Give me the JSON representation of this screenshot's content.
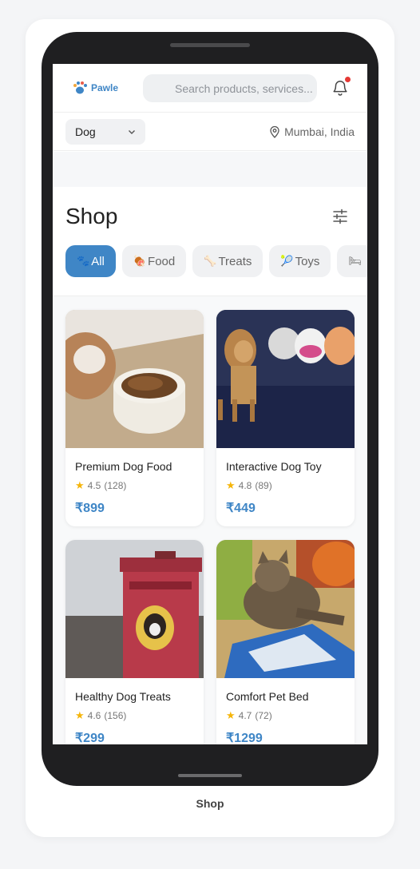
{
  "app": {
    "name": "Pawle"
  },
  "search": {
    "placeholder": "Search products, services..."
  },
  "notifications": {
    "has_unread": true
  },
  "pet_selector": {
    "value": "Dog"
  },
  "location": {
    "text": "Mumbai, India"
  },
  "page": {
    "title": "Shop",
    "caption": "Shop"
  },
  "categories": [
    {
      "label": "All",
      "icon": "paw-icon",
      "active": true
    },
    {
      "label": "Food",
      "icon": "meat-icon",
      "active": false
    },
    {
      "label": "Treats",
      "icon": "bone-icon",
      "active": false
    },
    {
      "label": "Toys",
      "icon": "ball-icon",
      "active": false
    },
    {
      "label": "",
      "icon": "bed-icon",
      "active": false
    }
  ],
  "products": [
    {
      "name": "Premium Dog Food",
      "rating": "4.5",
      "reviews": "(128)",
      "price": "₹899"
    },
    {
      "name": "Interactive Dog Toy",
      "rating": "4.8",
      "reviews": "(89)",
      "price": "₹449"
    },
    {
      "name": "Healthy Dog Treats",
      "rating": "4.6",
      "reviews": "(156)",
      "price": "₹299"
    },
    {
      "name": "Comfort Pet Bed",
      "rating": "4.7",
      "reviews": "(72)",
      "price": "₹1299"
    }
  ],
  "colors": {
    "accent": "#3f86c6",
    "star": "#f5b50a",
    "badge": "#e53935"
  }
}
